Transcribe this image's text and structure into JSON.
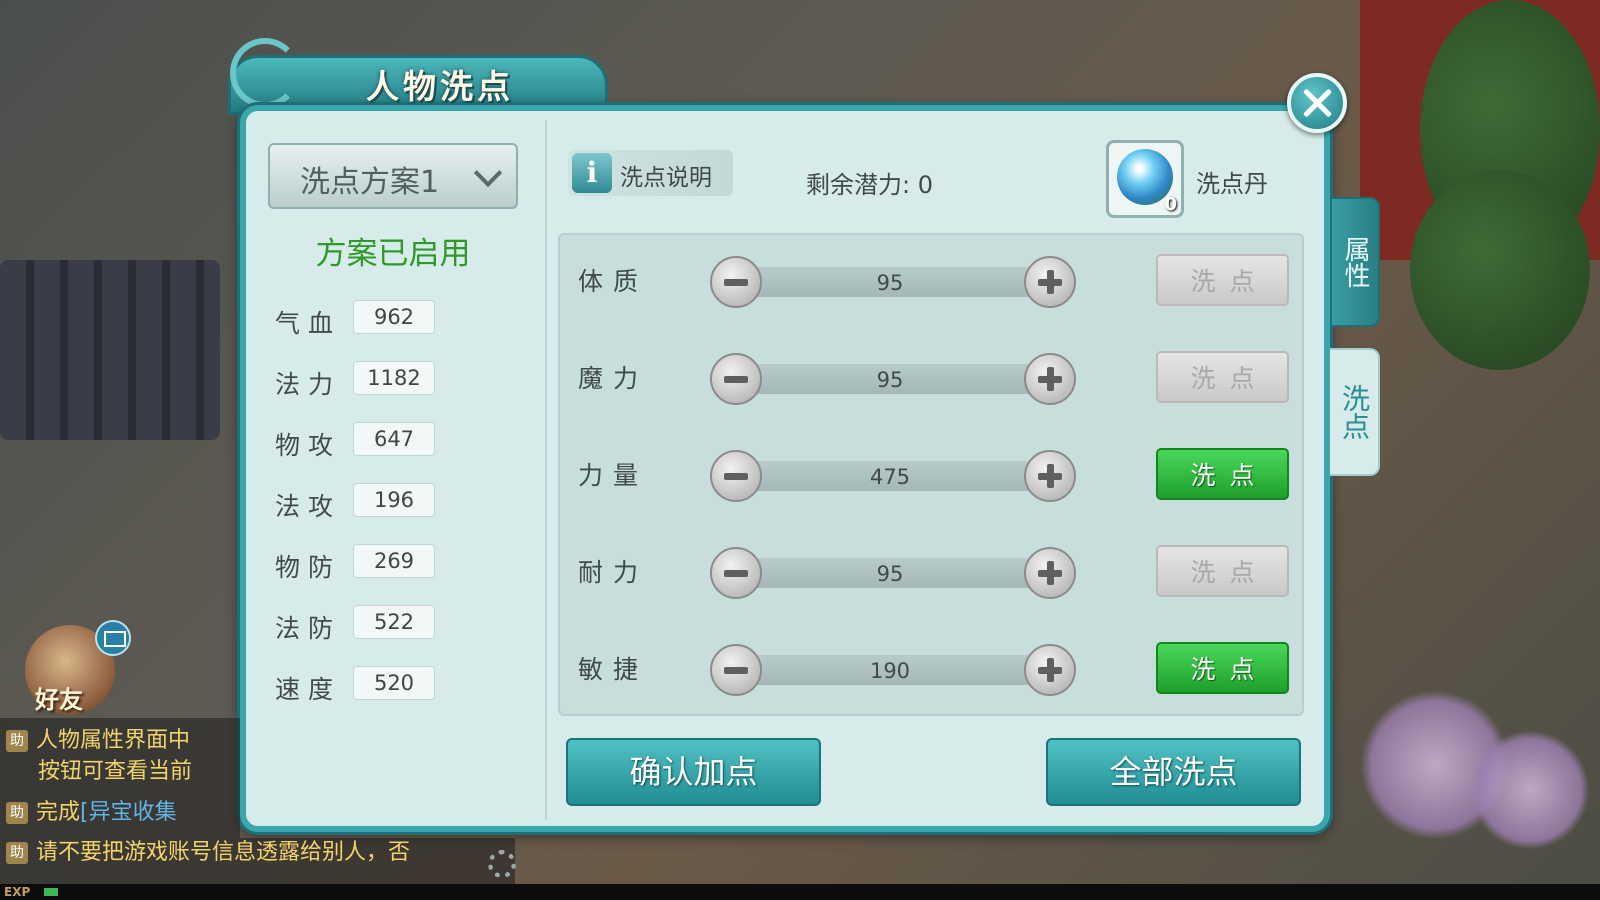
{
  "title": "人物洗点",
  "plan": {
    "selected": "洗点方案1",
    "status": "方案已启用"
  },
  "stats": [
    {
      "name": "气血",
      "value": "962"
    },
    {
      "name": "法力",
      "value": "1182"
    },
    {
      "name": "物攻",
      "value": "647"
    },
    {
      "name": "法攻",
      "value": "196"
    },
    {
      "name": "物防",
      "value": "269"
    },
    {
      "name": "法防",
      "value": "522"
    },
    {
      "name": "速度",
      "value": "520"
    }
  ],
  "info_button": {
    "icon": "i",
    "label": "洗点说明"
  },
  "remaining": "剩余潜力: 0",
  "item": {
    "name": "洗点丹",
    "count": "0"
  },
  "attributes": [
    {
      "name": "体质",
      "value": "95",
      "action": "洗点",
      "enabled": false
    },
    {
      "name": "魔力",
      "value": "95",
      "action": "洗点",
      "enabled": false
    },
    {
      "name": "力量",
      "value": "475",
      "action": "洗点",
      "enabled": true
    },
    {
      "name": "耐力",
      "value": "95",
      "action": "洗点",
      "enabled": false
    },
    {
      "name": "敏捷",
      "value": "190",
      "action": "洗点",
      "enabled": true
    }
  ],
  "buttons": {
    "confirm": "确认加点",
    "reset_all": "全部洗点"
  },
  "side_tabs": [
    {
      "label": "属性",
      "active": false
    },
    {
      "label": "洗点",
      "active": true
    }
  ],
  "hud": {
    "friend_label": "好友",
    "exp_label": "EXP",
    "chat": [
      {
        "tag": "助",
        "text": "人物属性界面中"
      },
      {
        "tag": "",
        "text": "按钮可查看当前"
      },
      {
        "tag": "助",
        "text": "完成",
        "link": "[异宝收集"
      },
      {
        "tag": "助",
        "text": "请不要把游戏账号信息透露给别人，否"
      }
    ]
  },
  "colors": {
    "panel_bg": "#d7ecea",
    "frame": "#3aa7ad",
    "enabled_button": "#2fbf3f",
    "status_green": "#2f9a2a"
  }
}
